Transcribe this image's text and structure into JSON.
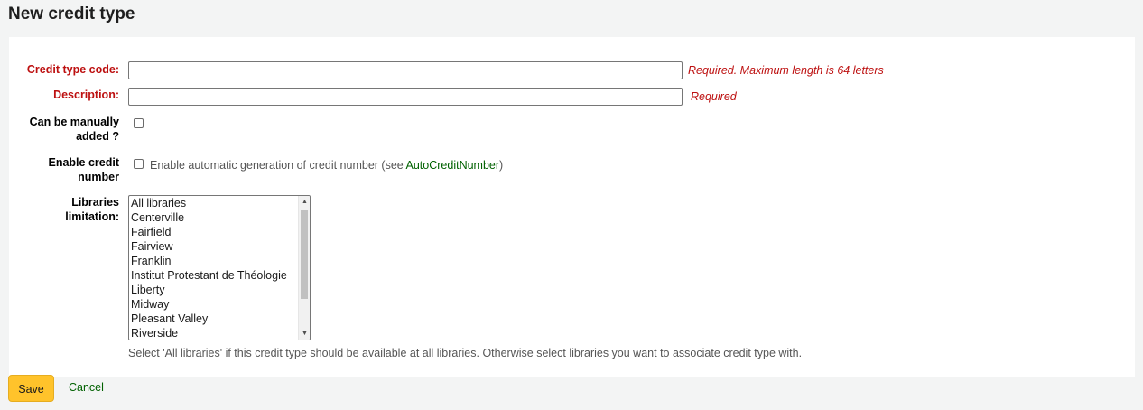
{
  "page": {
    "title": "New credit type"
  },
  "form": {
    "credit_type_code": {
      "label": "Credit type code:",
      "value": "",
      "note": "Required. Maximum length is 64 letters"
    },
    "description": {
      "label": "Description:",
      "value": "",
      "note": "Required"
    },
    "manually_added": {
      "label_line1": "Can be manually",
      "label_line2": "added ?",
      "checked": false
    },
    "credit_number": {
      "label_line1": "Enable credit",
      "label_line2": "number",
      "checked": false,
      "hint_prefix": "Enable automatic generation of credit number (see ",
      "hint_link": "AutoCreditNumber",
      "hint_suffix": ")"
    },
    "libraries": {
      "label_line1": "Libraries",
      "label_line2": "limitation:",
      "options": [
        "All libraries",
        "Centerville",
        "Fairfield",
        "Fairview",
        "Franklin",
        "Institut Protestant de Théologie",
        "Liberty",
        "Midway",
        "Pleasant Valley",
        "Riverside"
      ],
      "hint": "Select 'All libraries' if this credit type should be available at all libraries. Otherwise select libraries you want to associate credit type with."
    }
  },
  "actions": {
    "save_label": "Save",
    "cancel_label": "Cancel"
  },
  "colors": {
    "required_red": "#bd1010",
    "link_green": "#006100",
    "save_yellow": "#ffc32b"
  },
  "icons": {
    "scroll_up": "triangle-up-icon",
    "scroll_down": "triangle-down-icon"
  }
}
